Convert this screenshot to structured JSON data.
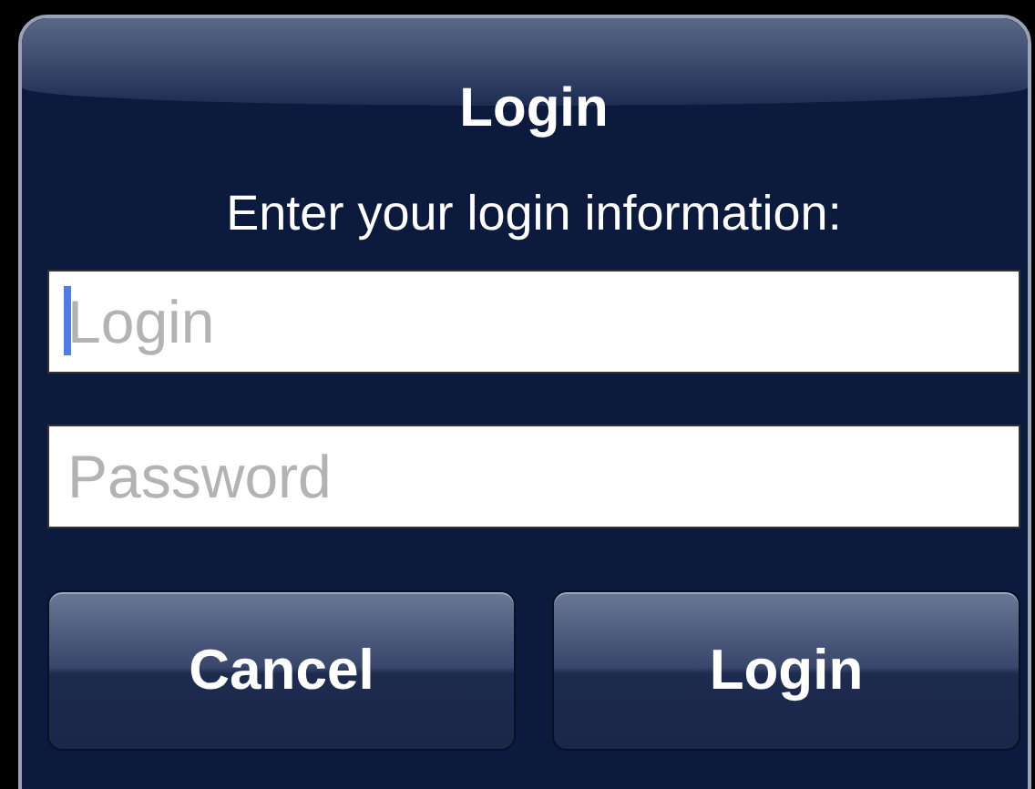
{
  "dialog": {
    "title": "Login",
    "message": "Enter your login information:",
    "fields": [
      {
        "placeholder": "Login",
        "focused": true
      },
      {
        "placeholder": "Password",
        "focused": false
      }
    ],
    "buttons": [
      {
        "label": "Cancel"
      },
      {
        "label": "Login"
      }
    ]
  }
}
